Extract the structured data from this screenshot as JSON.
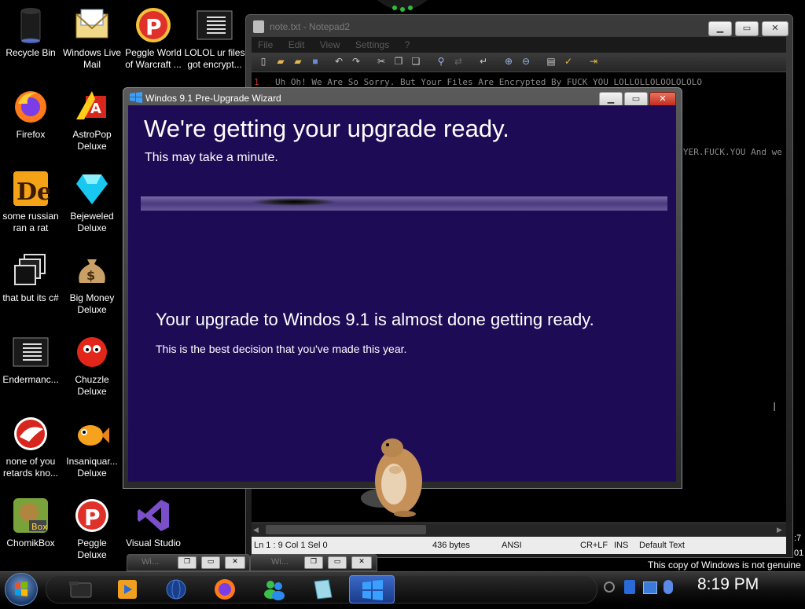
{
  "desktop": {
    "icons": [
      {
        "label": "Recycle Bin",
        "icon": "recycle-bin-icon"
      },
      {
        "label": "Windows Live Mail",
        "icon": "mail-icon"
      },
      {
        "label": "Peggle World of Warcraft ...",
        "icon": "peggle-icon"
      },
      {
        "label": "LOLOL ur files got encrypt...",
        "icon": "text-file-icon"
      },
      {
        "label": "Firefox",
        "icon": "firefox-icon"
      },
      {
        "label": "AstroPop Deluxe",
        "icon": "astropop-icon"
      },
      {
        "label": "some russian ran a rat",
        "icon": "de-app-icon"
      },
      {
        "label": "Bejeweled Deluxe",
        "icon": "gem-icon"
      },
      {
        "label": "that but its c#",
        "icon": "windows-stack-icon"
      },
      {
        "label": "Big Money Deluxe",
        "icon": "money-bag-icon"
      },
      {
        "label": "Endermanc...",
        "icon": "text-file-icon"
      },
      {
        "label": "Chuzzle Deluxe",
        "icon": "chuzzle-icon"
      },
      {
        "label": "none of you retards kno...",
        "icon": "red-bird-icon"
      },
      {
        "label": "Insaniquar... Deluxe",
        "icon": "fish-icon"
      },
      {
        "label": "ChomikBox",
        "icon": "chomikbox-icon"
      },
      {
        "label": "Peggle Deluxe",
        "icon": "peggle-icon"
      },
      {
        "label": "Visual Studio",
        "icon": "visual-studio-icon"
      }
    ]
  },
  "notepad": {
    "title": "note.txt - Notepad2",
    "menu": [
      "File",
      "Edit",
      "View",
      "Settings",
      "?"
    ],
    "line_number": "1",
    "line1": "Uh Oh! We Are So Sorry. But Your Files Are Encrypted By FUCK YOU LOLLOLLOLOOLOLOLO",
    "line2": "YER.FUCK.YOU And we",
    "status": {
      "position": "Ln 1 : 9   Col 1   Sel 0",
      "size": "436 bytes",
      "encoding": "ANSI",
      "line_endings": "CR+LF",
      "mode": "INS",
      "scheme": "Default Text"
    }
  },
  "wizard": {
    "title": "Windos 9.1 Pre-Upgrade Wizard",
    "heading": "We're getting your upgrade ready.",
    "subheading": "This may take a minute.",
    "message": "Your upgrade to Windos 9.1 is almost done getting ready.",
    "submessage": "This is the best decision that you've made this year.",
    "accent": "#1e0b56"
  },
  "taskbar": {
    "clock": "8:19 PM",
    "mini_windows": [
      "Wi...",
      "Wi..."
    ],
    "clock_partial": ":7",
    "clock_partial2": "01"
  },
  "watermark": "This copy of Windows is not genuine"
}
